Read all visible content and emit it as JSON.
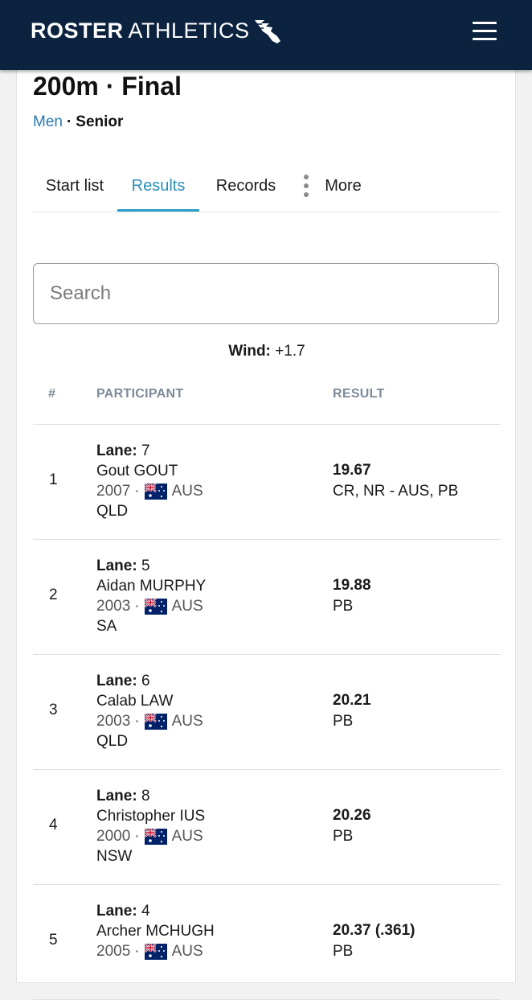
{
  "header": {
    "brand_bold": "ROSTER",
    "brand_light": "ATHLETICS"
  },
  "event": {
    "title": "200m · Final",
    "gender": "Men",
    "separator": "·",
    "category": "Senior"
  },
  "tabs": [
    {
      "label": "Start list"
    },
    {
      "label": "Results"
    },
    {
      "label": "Records"
    },
    {
      "label": "More"
    }
  ],
  "search": {
    "placeholder": "Search"
  },
  "wind": {
    "label": "Wind:",
    "value": "+1.7"
  },
  "table": {
    "columns": [
      "#",
      "PARTICIPANT",
      "RESULT"
    ],
    "lane_label": "Lane:",
    "rows": [
      {
        "rank": "1",
        "lane": "7",
        "name": "Gout GOUT",
        "year": "2007",
        "sep": "·",
        "country": "AUS",
        "state": "QLD",
        "time": "19.67",
        "notes": "CR, NR - AUS, PB"
      },
      {
        "rank": "2",
        "lane": "5",
        "name": "Aidan MURPHY",
        "year": "2003",
        "sep": "·",
        "country": "AUS",
        "state": "SA",
        "time": "19.88",
        "notes": "PB"
      },
      {
        "rank": "3",
        "lane": "6",
        "name": "Calab LAW",
        "year": "2003",
        "sep": "·",
        "country": "AUS",
        "state": "QLD",
        "time": "20.21",
        "notes": "PB"
      },
      {
        "rank": "4",
        "lane": "8",
        "name": "Christopher IUS",
        "year": "2000",
        "sep": "·",
        "country": "AUS",
        "state": "NSW",
        "time": "20.26",
        "notes": "PB"
      },
      {
        "rank": "5",
        "lane": "4",
        "name": "Archer MCHUGH",
        "year": "2005",
        "sep": "·",
        "country": "AUS",
        "state": "",
        "time": "20.37 (.361)",
        "notes": "PB"
      }
    ]
  },
  "colors": {
    "header_bg": "#0c2340",
    "accent": "#2a8fb9",
    "link": "#2a7ab0"
  },
  "icons": {
    "menu": "hamburger-menu-icon",
    "more": "vertical-dots-icon",
    "flag": "australia-flag-icon",
    "logo": "winged-shoe-icon"
  }
}
